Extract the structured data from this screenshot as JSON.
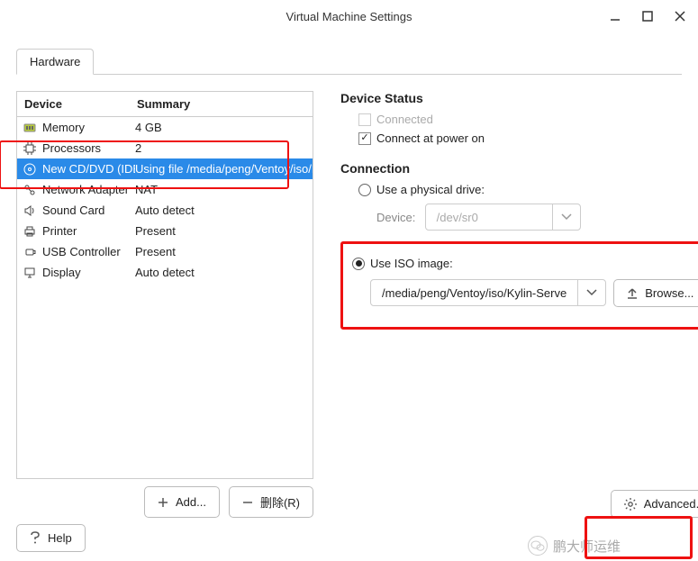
{
  "window": {
    "title": "Virtual Machine Settings"
  },
  "tabs": {
    "hardware": "Hardware"
  },
  "table": {
    "head_device": "Device",
    "head_summary": "Summary",
    "rows": [
      {
        "dev": "Memory",
        "sum": "4 GB",
        "icon": "mem-icon"
      },
      {
        "dev": "Processors",
        "sum": "2",
        "icon": "cpu-icon"
      },
      {
        "dev": "New CD/DVD (IDE)",
        "sum": "Using file /media/peng/Ventoy/iso/Kyli…",
        "icon": "cd-icon",
        "selected": true
      },
      {
        "dev": "Network Adapter",
        "sum": "NAT",
        "icon": "net-icon"
      },
      {
        "dev": "Sound Card",
        "sum": "Auto detect",
        "icon": "sound-icon"
      },
      {
        "dev": "Printer",
        "sum": "Present",
        "icon": "printer-icon"
      },
      {
        "dev": "USB Controller",
        "sum": "Present",
        "icon": "usb-icon"
      },
      {
        "dev": "Display",
        "sum": "Auto detect",
        "icon": "display-icon"
      }
    ]
  },
  "left_buttons": {
    "add": "Add...",
    "remove": "删除(R)"
  },
  "right": {
    "device_status_title": "Device Status",
    "connected": "Connected",
    "connect_power": "Connect at power on",
    "connection_title": "Connection",
    "use_physical": "Use a physical drive:",
    "device_label": "Device:",
    "phys_value": "/dev/sr0",
    "use_iso": "Use ISO image:",
    "iso_value": "/media/peng/Ventoy/iso/Kylin-Serve",
    "browse": "Browse...",
    "advanced": "Advanced..."
  },
  "footer": {
    "help": "Help"
  },
  "watermark": {
    "text": "鹏大师运维"
  }
}
